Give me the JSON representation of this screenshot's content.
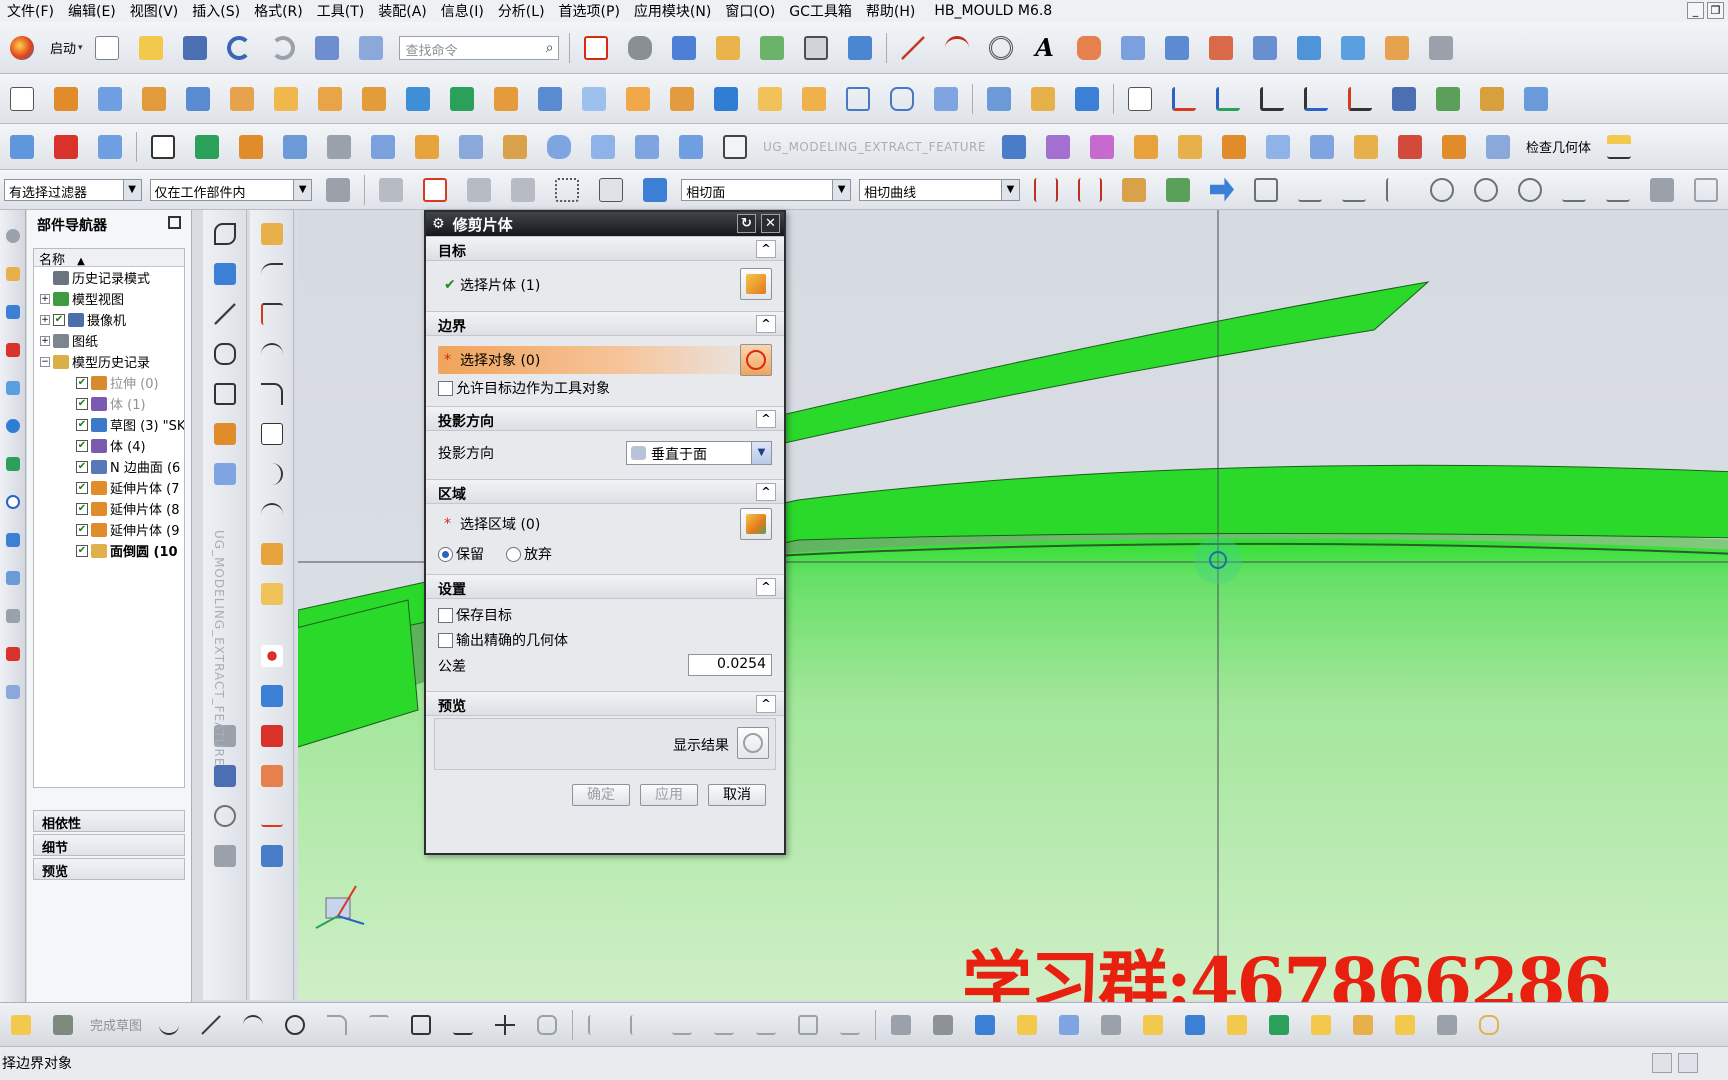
{
  "menubar": {
    "items": [
      "文件(F)",
      "编辑(E)",
      "视图(V)",
      "插入(S)",
      "格式(R)",
      "工具(T)",
      "装配(A)",
      "信息(I)",
      "分析(L)",
      "首选项(P)",
      "应用模块(N)",
      "窗口(O)",
      "GC工具箱",
      "帮助(H)"
    ],
    "app_title": "HB_MOULD M6.8"
  },
  "toolbar": {
    "start_label": "启动",
    "search_placeholder": "查找命令",
    "extract_feature_label": "UG_MODELING_EXTRACT_FEATURE",
    "check_geometry_label": "检查几何体"
  },
  "selection_bar": {
    "type_filter": "有选择过滤器",
    "scope": "仅在工作部件内",
    "face_rule": "相切面",
    "curve_rule": "相切曲线"
  },
  "navigator": {
    "title": "部件导航器",
    "column_name": "名称",
    "items": [
      {
        "label": "历史记录模式",
        "level": 0,
        "expand": "",
        "check": false,
        "icon": "#6a7480",
        "dim": false,
        "bold": false
      },
      {
        "label": "模型视图",
        "level": 0,
        "expand": "+",
        "check": false,
        "icon": "#3e9b3e",
        "dim": false,
        "bold": false
      },
      {
        "label": "摄像机",
        "level": 0,
        "expand": "+",
        "check": true,
        "icon": "#4c6fa8",
        "dim": false,
        "bold": false
      },
      {
        "label": "图纸",
        "level": 0,
        "expand": "+",
        "check": false,
        "icon": "#7c8590",
        "dim": false,
        "bold": false
      },
      {
        "label": "模型历史记录",
        "level": 0,
        "expand": "-",
        "check": false,
        "icon": "#d9b048",
        "dim": false,
        "bold": false
      },
      {
        "label": "拉伸 (0)",
        "level": 1,
        "expand": "",
        "check": true,
        "icon": "#d98a2c",
        "dim": true,
        "bold": false
      },
      {
        "label": "体 (1)",
        "level": 1,
        "expand": "",
        "check": true,
        "icon": "#7b5bb0",
        "dim": true,
        "bold": false
      },
      {
        "label": "草图 (3) \"SK",
        "level": 1,
        "expand": "",
        "check": true,
        "icon": "#3c7ac9",
        "dim": false,
        "bold": false
      },
      {
        "label": "体 (4)",
        "level": 1,
        "expand": "",
        "check": true,
        "icon": "#7b5bb0",
        "dim": false,
        "bold": false
      },
      {
        "label": "N 边曲面 (6",
        "level": 1,
        "expand": "",
        "check": true,
        "icon": "#5a78b8",
        "dim": false,
        "bold": false
      },
      {
        "label": "延伸片体 (7",
        "level": 1,
        "expand": "",
        "check": true,
        "icon": "#e08c2a",
        "dim": false,
        "bold": false
      },
      {
        "label": "延伸片体 (8",
        "level": 1,
        "expand": "",
        "check": true,
        "icon": "#e08c2a",
        "dim": false,
        "bold": false
      },
      {
        "label": "延伸片体 (9",
        "level": 1,
        "expand": "",
        "check": true,
        "icon": "#e08c2a",
        "dim": false,
        "bold": false
      },
      {
        "label": "面倒圆 (10",
        "level": 1,
        "expand": "",
        "check": true,
        "icon": "#e0b04a",
        "dim": false,
        "bold": true
      }
    ],
    "panels": [
      "相依性",
      "细节",
      "预览"
    ]
  },
  "dialog": {
    "title": "修剪片体",
    "sections": {
      "target": {
        "title": "目标",
        "select_label": "选择片体 (1)"
      },
      "boundary": {
        "title": "边界",
        "select_label": "选择对象 (0)",
        "allow_edges_label": "允许目标边作为工具对象"
      },
      "projection": {
        "title": "投影方向",
        "label": "投影方向",
        "value": "垂直于面"
      },
      "region": {
        "title": "区域",
        "select_label": "选择区域 (0)",
        "keep_label": "保留",
        "discard_label": "放弃"
      },
      "settings": {
        "title": "设置",
        "keep_target_label": "保存目标",
        "precise_geometry_label": "输出精确的几何体",
        "tolerance_label": "公差",
        "tolerance_value": "0.0254"
      },
      "preview": {
        "title": "预览",
        "show_result_label": "显示结果"
      }
    },
    "buttons": {
      "ok": "确定",
      "apply": "应用",
      "cancel": "取消"
    }
  },
  "sidebar_vertical_label": "UG_MODELING_EXTRACT_FEATURE",
  "bottom_toolbar": {
    "finish_sketch_label": "完成草图"
  },
  "watermark": "学习群:467866286",
  "status": {
    "message": "择边界对象"
  },
  "colors": {
    "surface_green": "#2bd92b",
    "active_orange": "#f0a45c",
    "watermark_red": "#e8200f"
  }
}
